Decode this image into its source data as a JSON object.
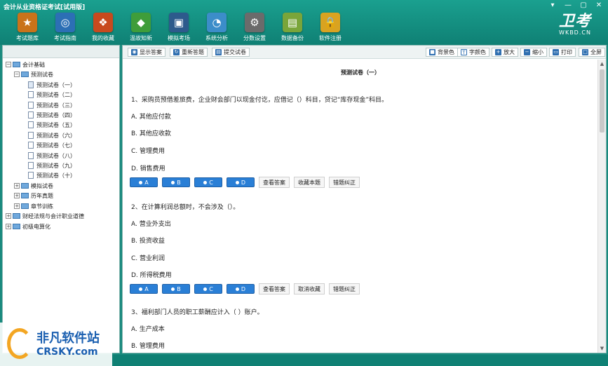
{
  "app": {
    "title": "会计从业资格证考试[试用版]"
  },
  "window_controls": [
    "▾",
    "—",
    "▢",
    "✕"
  ],
  "toolbar": [
    {
      "label": "考试题库",
      "icon": "book-icon",
      "color": "#c9731a",
      "glyph": "★"
    },
    {
      "label": "考试指南",
      "icon": "compass-icon",
      "color": "#2c6fb5",
      "glyph": "◎"
    },
    {
      "label": "我的收藏",
      "icon": "favorites-icon",
      "color": "#c84a1e",
      "glyph": "❖"
    },
    {
      "label": "温故知新",
      "icon": "review-icon",
      "color": "#3f9d3a",
      "glyph": "◆"
    },
    {
      "label": "模拟考场",
      "icon": "monitor-icon",
      "color": "#2d5a8c",
      "glyph": "▣"
    },
    {
      "label": "系统分析",
      "icon": "pie-chart-icon",
      "color": "#3c8dc9",
      "glyph": "◔"
    },
    {
      "label": "分数设置",
      "icon": "settings-icon",
      "color": "#6b6b6b",
      "glyph": "⚙"
    },
    {
      "label": "数据备份",
      "icon": "backup-icon",
      "color": "#7aa53a",
      "glyph": "▤"
    },
    {
      "label": "软件注册",
      "icon": "lock-icon",
      "color": "#d9a321",
      "glyph": "🔒"
    }
  ],
  "brand": {
    "name": "卫考",
    "url": "WKBD.CN"
  },
  "tree": {
    "root": "会计基础",
    "group": "预测试卷",
    "papers": [
      "预测试卷（一）",
      "预测试卷（二）",
      "预测试卷（三）",
      "预测试卷（四）",
      "预测试卷（五）",
      "预测试卷（六）",
      "预测试卷（七）",
      "预测试卷（八）",
      "预测试卷（九）",
      "预测试卷（十）"
    ],
    "others": [
      "模拟试卷",
      "历年真题",
      "章节训练"
    ],
    "subjects": [
      "财经法规与会计职业道德",
      "初级电算化"
    ]
  },
  "content_toolbar": {
    "show_answer": "显示答案",
    "redo": "重新答题",
    "submit": "提交试卷",
    "bg_color": "背景色",
    "font_color": "字颜色",
    "zoom_in": "放大",
    "zoom_out": "缩小",
    "print": "打印",
    "fullscreen": "全屏"
  },
  "paper": {
    "title": "预测试卷（一）",
    "questions": [
      {
        "text": "1、采购员预借差旅费，企业财会部门以现金付讫，应借记（）科目，贷记“库存现金”科目。",
        "options": [
          "A. 其他应付款",
          "B. 其他应收款",
          "C. 管理费用",
          "D. 销售费用"
        ],
        "buttons": [
          "A",
          "B",
          "C",
          "D"
        ],
        "actions": [
          "查看答案",
          "收藏本题",
          "错题纠正"
        ]
      },
      {
        "text": "2、在计算利润总额时，不会涉及（）。",
        "options": [
          "A. 营业外支出",
          "B. 投资收益",
          "C. 营业利润",
          "D. 所得税费用"
        ],
        "buttons": [
          "A",
          "B",
          "C",
          "D"
        ],
        "actions": [
          "查看答案",
          "取消收藏",
          "错题纠正"
        ]
      },
      {
        "text": "3、福利部门人员的职工薪酬应计入（    ）账户。",
        "options": [
          "A. 生产成本",
          "B. 管理费用"
        ]
      }
    ]
  },
  "watermark": {
    "line1": "非凡软件站",
    "line2": "CRSKY.com"
  }
}
